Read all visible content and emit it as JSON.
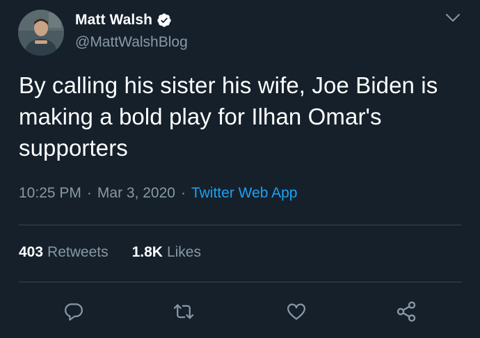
{
  "author": {
    "display_name": "Matt Walsh",
    "handle": "@MattWalshBlog",
    "verified": true,
    "avatar": "avatar-photo"
  },
  "tweet": {
    "text": "By calling his sister his wife, Joe Biden is making a bold play for Ilhan Omar's supporters",
    "time": "10:25 PM",
    "date": "Mar 3, 2020",
    "separator": "·",
    "source": "Twitter Web App"
  },
  "stats": {
    "retweets_count": "403",
    "retweets_label": "Retweets",
    "likes_count": "1.8K",
    "likes_label": "Likes"
  },
  "actions": [
    "reply-icon",
    "retweet-icon",
    "like-icon",
    "share-icon"
  ],
  "colors": {
    "background": "#15202b",
    "text_primary": "#ffffff",
    "text_secondary": "#8899a6",
    "accent": "#1da1f2",
    "divider": "#38444d"
  }
}
